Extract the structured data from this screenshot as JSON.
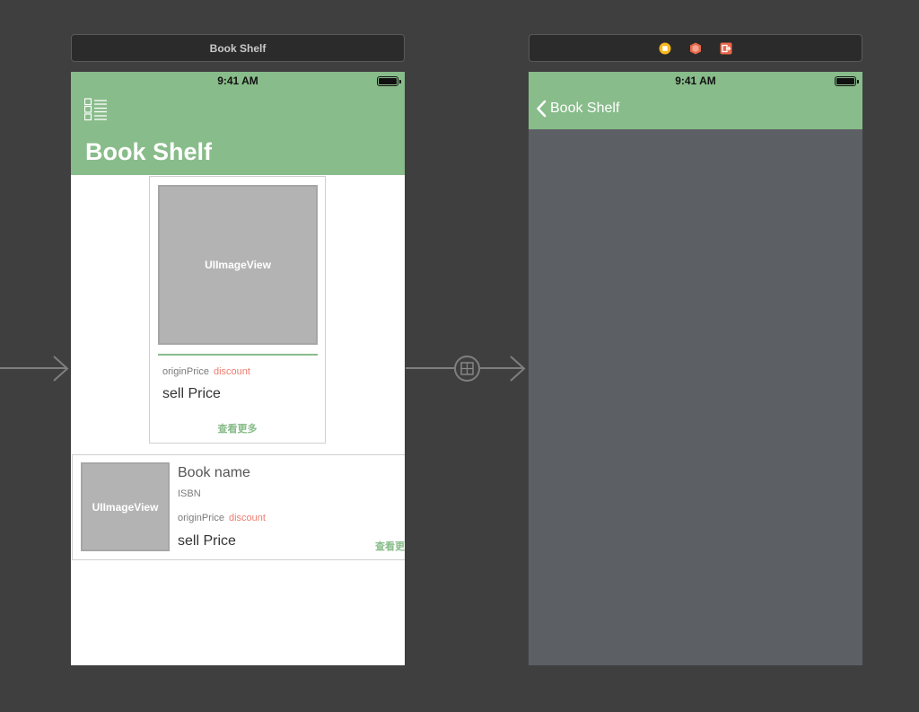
{
  "scene1": {
    "dock_title": "Book Shelf",
    "status_time": "9:41 AM",
    "large_title": "Book Shelf",
    "grid_cell": {
      "image_label": "UIImageView",
      "origin_price": "originPrice",
      "discount": "discount",
      "sell_price": "sell Price",
      "more": "查看更多"
    },
    "list_cell": {
      "image_label": "UIImageView",
      "book_name": "Book name",
      "isbn": "ISBN",
      "origin_price": "originPrice",
      "discount": "discount",
      "sell_price": "sell Price",
      "more": "查看更多"
    }
  },
  "scene2": {
    "dock_icons": [
      "view-controller-icon",
      "first-responder-icon",
      "exit-icon"
    ],
    "status_time": "9:41 AM",
    "back_label": "Book Shelf"
  },
  "colors": {
    "canvas": "#3f3f3f",
    "nav_green": "#88bc8a",
    "discount_red": "#ef7d6f",
    "placeholder_gray": "#b3b3b3",
    "empty_view": "#5c6065"
  }
}
